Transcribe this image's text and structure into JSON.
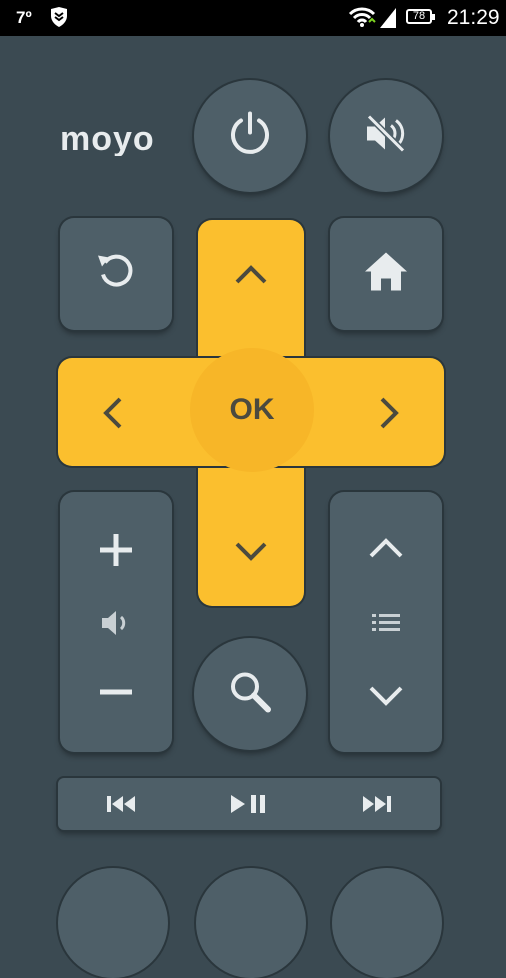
{
  "status_bar": {
    "temperature": "7º",
    "battery": "78",
    "time": "21:29",
    "icons": [
      "shield-icon",
      "wifi-icon",
      "signal-icon",
      "battery-icon"
    ]
  },
  "brand": {
    "logo_text": "moyo"
  },
  "buttons": {
    "power": "power-icon",
    "mute": "volume-mute-icon",
    "back": "replay-icon",
    "home": "home-icon",
    "search": "search-icon"
  },
  "dpad": {
    "ok_label": "OK",
    "up": "chevron-up-icon",
    "down": "chevron-down-icon",
    "left": "chevron-left-icon",
    "right": "chevron-right-icon"
  },
  "volume": {
    "plus": "plus-icon",
    "speaker": "volume-icon",
    "minus": "minus-icon"
  },
  "channel": {
    "up": "chevron-up-icon",
    "list": "list-icon",
    "down": "chevron-down-icon"
  },
  "media": [
    "rewind-icon",
    "play-pause-icon",
    "fast-forward-icon"
  ],
  "colors": {
    "background": "#3b4a52",
    "button": "#4e5f68",
    "accent": "#fbbf2e",
    "icon": "#e8ecee"
  }
}
